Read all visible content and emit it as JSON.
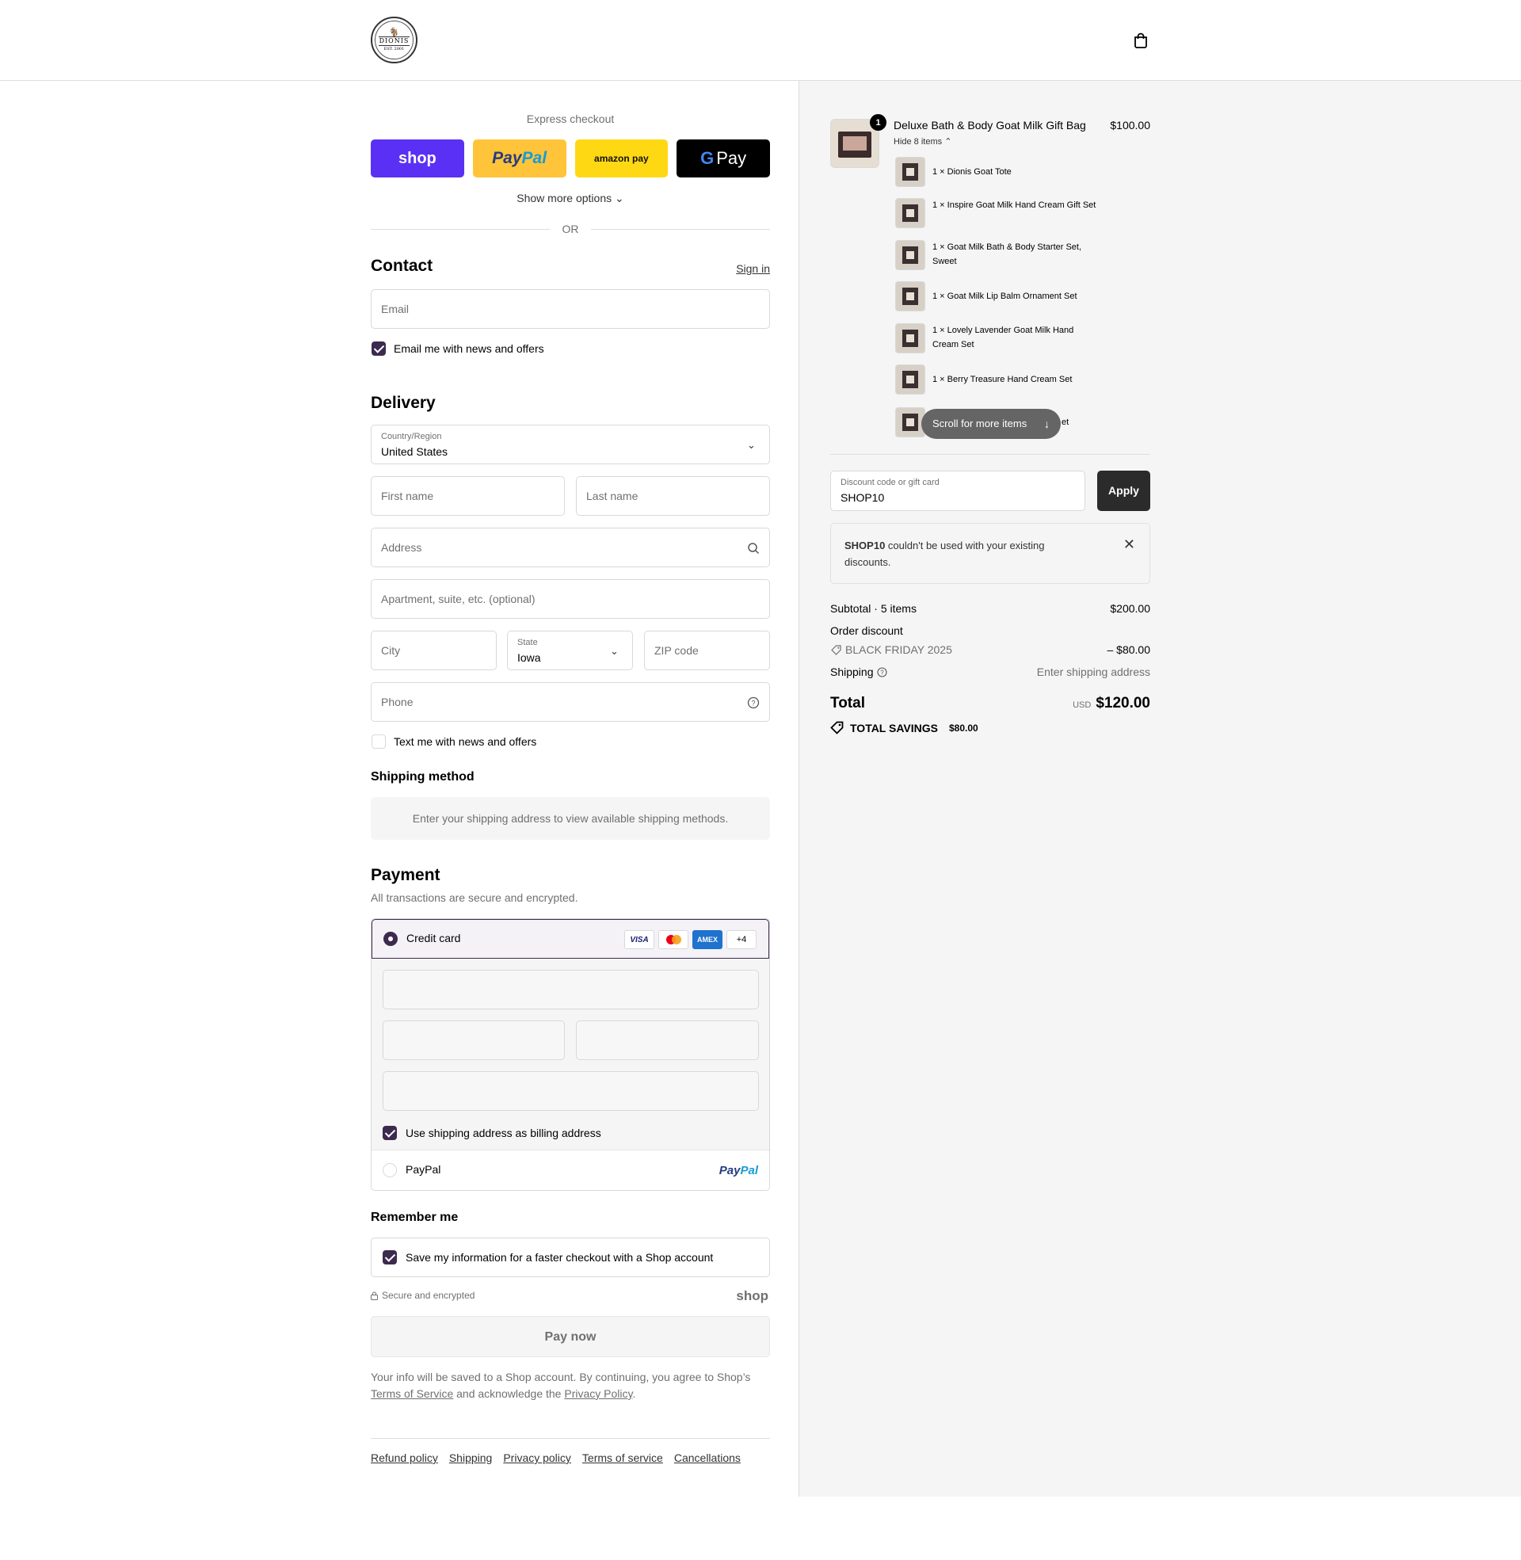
{
  "header": {
    "logo_text": "DIONIS",
    "logo_est": "EST. 2001",
    "cart_icon": "shopping-bag-icon"
  },
  "express": {
    "title": "Express checkout",
    "buttons": {
      "shop": "shop",
      "paypal_a": "Pay",
      "paypal_b": "Pal",
      "amazon": "amazon pay",
      "gpay_g": "G",
      "gpay": "Pay"
    },
    "more_options": "Show more options",
    "or": "OR"
  },
  "contact": {
    "title": "Contact",
    "sign_in": "Sign in",
    "email_placeholder": "Email",
    "news_checkbox": "Email me with news and offers"
  },
  "delivery": {
    "title": "Delivery",
    "country_label": "Country/Region",
    "country_value": "United States",
    "first_name": "First name",
    "last_name": "Last name",
    "address": "Address",
    "apartment": "Apartment, suite, etc. (optional)",
    "city": "City",
    "state_label": "State",
    "state_value": "Iowa",
    "zip": "ZIP code",
    "phone": "Phone",
    "text_checkbox": "Text me with news and offers"
  },
  "shipping_method": {
    "title": "Shipping method",
    "note": "Enter your shipping address to view available shipping methods."
  },
  "payment": {
    "title": "Payment",
    "subtitle": "All transactions are secure and encrypted.",
    "credit_card": "Credit card",
    "card_brands": [
      "VISA",
      "MC",
      "AMEX",
      "+4"
    ],
    "billing_checkbox": "Use shipping address as billing address",
    "paypal": "PayPal",
    "paypal_logo_a": "Pay",
    "paypal_logo_b": "Pal"
  },
  "remember": {
    "title": "Remember me",
    "checkbox": "Save my information for a faster checkout with a Shop account",
    "secure": "Secure and encrypted",
    "shop_logo": "shop"
  },
  "pay_now": "Pay now",
  "legal": {
    "text1": "Your info will be saved to a Shop account. By continuing, you agree to Shop’s",
    "terms_link": "Terms of Service",
    "text2": " and acknowledge the ",
    "privacy_link": "Privacy Policy",
    "text3": "."
  },
  "footer_links": [
    "Refund policy",
    "Shipping",
    "Privacy policy",
    "Terms of service",
    "Cancellations"
  ],
  "order": {
    "product": {
      "quantity": "1",
      "title": "Deluxe Bath & Body Goat Milk Gift Bag",
      "price": "$100.00",
      "hide_items": "Hide 8 items"
    },
    "items": [
      {
        "qty": "1 ×",
        "name": "Dionis Goat Tote"
      },
      {
        "qty": "1 ×",
        "name": "Inspire Goat Milk Hand Cream Gift Set"
      },
      {
        "qty": "1 ×",
        "name": "Goat Milk Bath & Body Starter Set, Sweet"
      },
      {
        "qty": "1 ×",
        "name": "Goat Milk Lip Balm Ornament Set"
      },
      {
        "qty": "1 ×",
        "name": "Lovely Lavender Goat Milk Hand Cream Set"
      },
      {
        "qty": "1 ×",
        "name": "Berry Treasure Hand Cream Set"
      },
      {
        "qty": "",
        "name": "et"
      }
    ],
    "scroll_pill": "Scroll for more items",
    "discount_label": "Discount code or gift card",
    "discount_value": "SHOP10",
    "apply": "Apply",
    "error_code": "SHOP10",
    "error_text": " couldn't be used with your existing discounts.",
    "subtotal_label": "Subtotal · 5 items",
    "subtotal_value": "$200.00",
    "order_discount_label": "Order discount",
    "discount_name": "BLACK FRIDAY 2025",
    "discount_amount": "– $80.00",
    "shipping_label": "Shipping",
    "shipping_value": "Enter shipping address",
    "total_label": "Total",
    "total_currency": "USD",
    "total_value": "$120.00",
    "savings_label": "TOTAL SAVINGS",
    "savings_value": "$80.00"
  }
}
